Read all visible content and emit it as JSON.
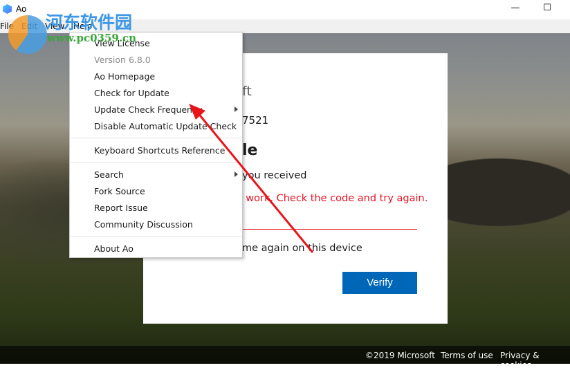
{
  "window": {
    "title": "Ao",
    "minimize": "—",
    "maximize": "☐"
  },
  "menubar": [
    "File",
    "Edit",
    "View",
    "Help"
  ],
  "help_menu": {
    "groups": [
      [
        {
          "label": "View License"
        },
        {
          "label": "Version 6.8.0",
          "disabled": true
        },
        {
          "label": "Ao Homepage"
        },
        {
          "label": "Check for Update"
        },
        {
          "label": "Update Check Frequency",
          "submenu": true
        },
        {
          "label": "Disable Automatic Update Check"
        }
      ],
      [
        {
          "label": "Keyboard Shortcuts Reference"
        }
      ],
      [
        {
          "label": "Search",
          "submenu": true
        },
        {
          "label": "Fork Source"
        },
        {
          "label": "Report Issue"
        },
        {
          "label": "Community Discussion"
        }
      ],
      [
        {
          "label": "About Ao"
        }
      ]
    ]
  },
  "card": {
    "brand_fragment": "ft",
    "number_fragment": "7521",
    "heading_fragment": "le",
    "instruction_fragment": "you received",
    "error_fragment": "'t work. Check the code and try again.",
    "remember_fragment": "me again on this device",
    "verify_label": "Verify",
    "error_color": "#e81123",
    "accent_color": "#0067b8"
  },
  "footer": {
    "copyright": "©2019 Microsoft",
    "terms": "Terms of use",
    "privacy": "Privacy & cookies"
  },
  "watermark": {
    "cn": "河东软件园",
    "url": "www.pc0359.cn"
  }
}
